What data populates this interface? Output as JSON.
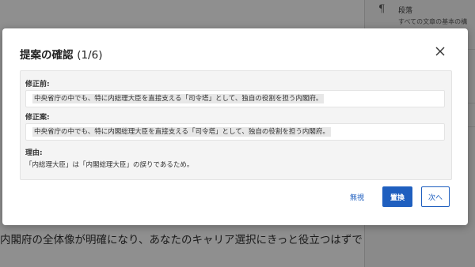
{
  "background": {
    "editor_text": "内閣府の全体像が明確になり、あなたのキャリア選択にきっと役立つはずで",
    "panel": {
      "icon": "pilcrow-icon",
      "title": "段落",
      "description": "すべての文章の基本の構"
    }
  },
  "dialog": {
    "title": "提案の確認",
    "count": "(1/6)",
    "close_icon": "close-icon",
    "before_label": "修正前:",
    "before_text": "中央省庁の中でも、特に内総理大臣を直接支える「司令塔」として、独自の役割を担う内閣府。",
    "after_label": "修正案:",
    "after_text": "中央省庁の中でも、特に内閣総理大臣を直接支える「司令塔」として、独自の役割を担う内閣府。",
    "reason_label": "理由:",
    "reason_text": "「内総理大臣」は「内閣総理大臣」の誤りであるため。",
    "ignore_label": "無視",
    "replace_label": "置換",
    "next_label": "次へ"
  }
}
